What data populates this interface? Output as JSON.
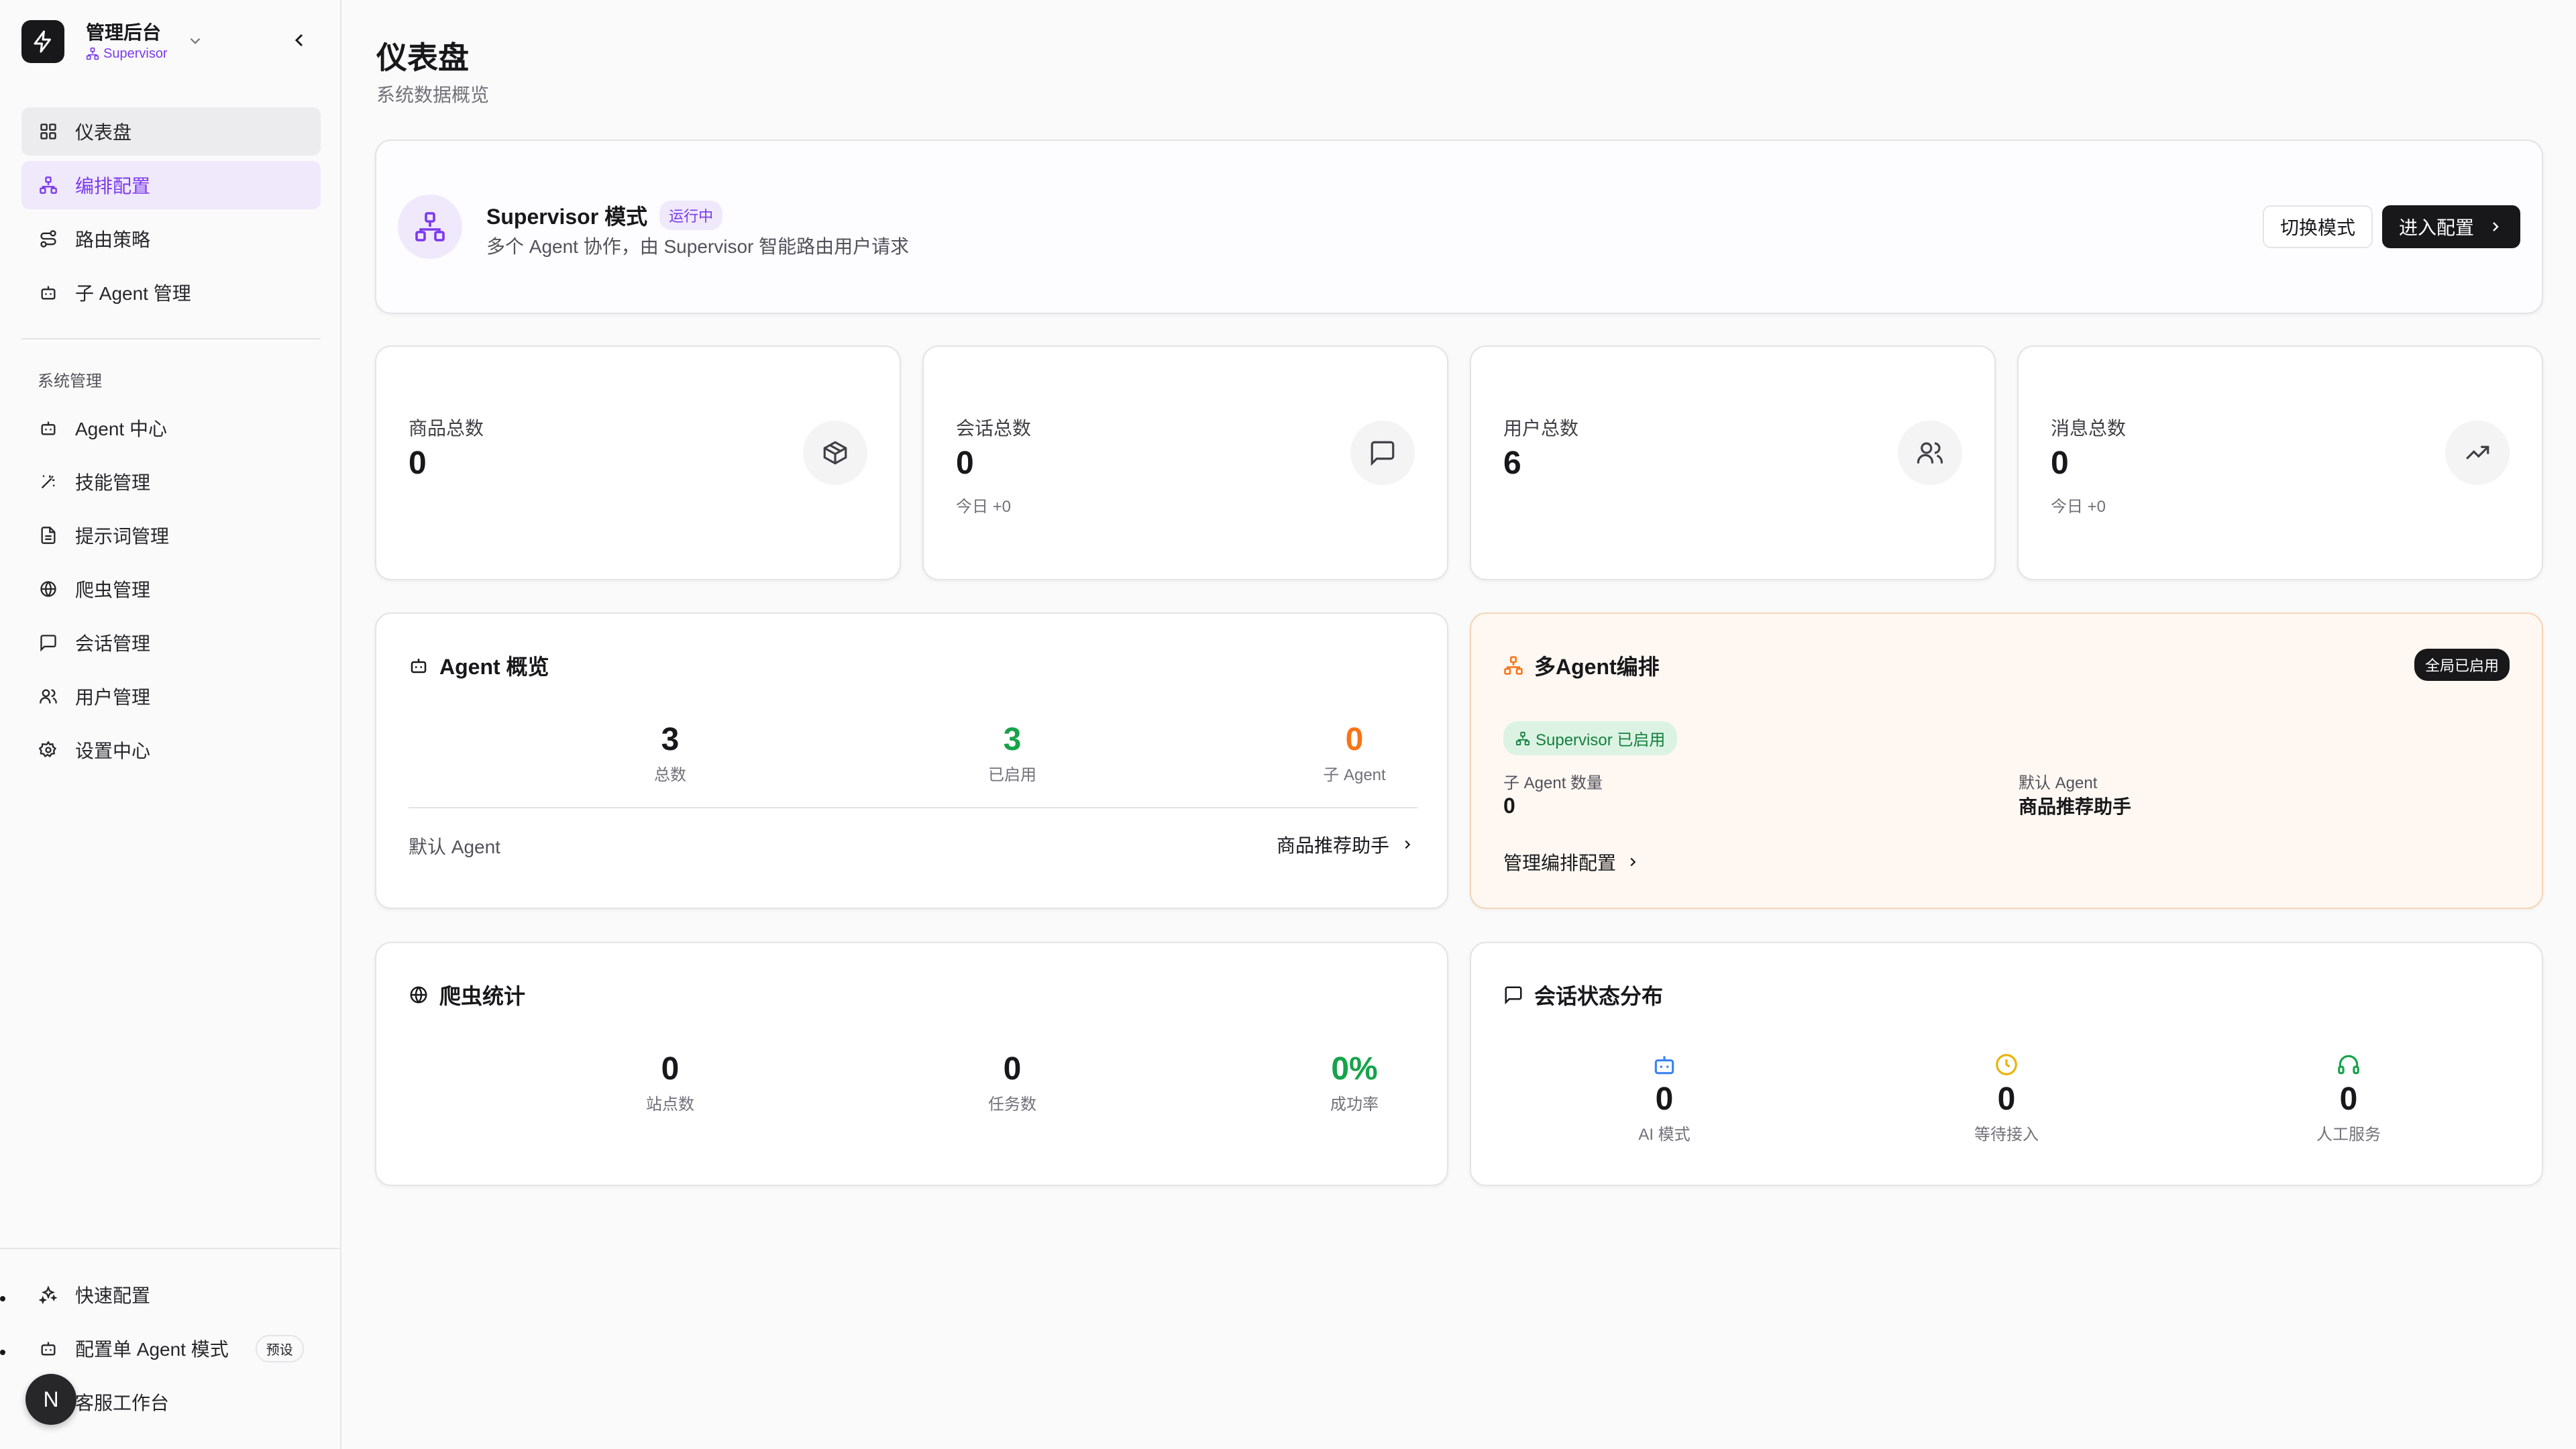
{
  "sidebar": {
    "brand_title": "管理后台",
    "brand_sub": "Supervisor",
    "nav": [
      {
        "label": "仪表盘"
      },
      {
        "label": "编排配置"
      },
      {
        "label": "路由策略"
      },
      {
        "label": "子 Agent 管理"
      }
    ],
    "group_label": "系统管理",
    "system": [
      {
        "label": "Agent 中心"
      },
      {
        "label": "技能管理"
      },
      {
        "label": "提示词管理"
      },
      {
        "label": "爬虫管理"
      },
      {
        "label": "会话管理"
      },
      {
        "label": "用户管理"
      },
      {
        "label": "设置中心"
      }
    ],
    "bottom": [
      {
        "label": "快速配置"
      },
      {
        "label": "配置单 Agent 模式",
        "badge": "预设"
      },
      {
        "label": "客服工作台"
      }
    ],
    "avatar_initial": "N"
  },
  "page": {
    "title": "仪表盘",
    "subtitle": "系统数据概览"
  },
  "mode_card": {
    "title": "Supervisor 模式",
    "status": "运行中",
    "desc": "多个 Agent 协作，由 Supervisor 智能路由用户请求",
    "switch_label": "切换模式",
    "enter_label": "进入配置"
  },
  "stats": [
    {
      "label": "商品总数",
      "value": "0",
      "today": ""
    },
    {
      "label": "会话总数",
      "value": "0",
      "today": "今日 +0"
    },
    {
      "label": "用户总数",
      "value": "6",
      "today": ""
    },
    {
      "label": "消息总数",
      "value": "0",
      "today": "今日 +0"
    }
  ],
  "agent_overview": {
    "title": "Agent 概览",
    "metrics": [
      {
        "value": "3",
        "label": "总数"
      },
      {
        "value": "3",
        "label": "已启用"
      },
      {
        "value": "0",
        "label": "子 Agent"
      }
    ],
    "default_label": "默认 Agent",
    "default_value": "商品推荐助手"
  },
  "orchestration": {
    "title": "多Agent编排",
    "global_badge": "全局已启用",
    "supervisor_badge": "Supervisor 已启用",
    "sub_count_label": "子 Agent 数量",
    "sub_count_value": "0",
    "default_label": "默认 Agent",
    "default_value": "商品推荐助手",
    "manage_link": "管理编排配置"
  },
  "crawler": {
    "title": "爬虫统计",
    "metrics": [
      {
        "value": "0",
        "label": "站点数"
      },
      {
        "value": "0",
        "label": "任务数"
      },
      {
        "value": "0%",
        "label": "成功率"
      }
    ]
  },
  "conversation_status": {
    "title": "会话状态分布",
    "metrics": [
      {
        "value": "0",
        "label": "AI 模式",
        "icon": "bot-icon"
      },
      {
        "value": "0",
        "label": "等待接入",
        "icon": "clock-icon"
      },
      {
        "value": "0",
        "label": "人工服务",
        "icon": "headset-icon"
      }
    ]
  },
  "colors": {
    "accent_purple": "#7c3aed",
    "green": "#16a34a",
    "orange": "#f97316",
    "blue": "#3b82f6",
    "yellow": "#eab308",
    "dark": "#18181b"
  }
}
